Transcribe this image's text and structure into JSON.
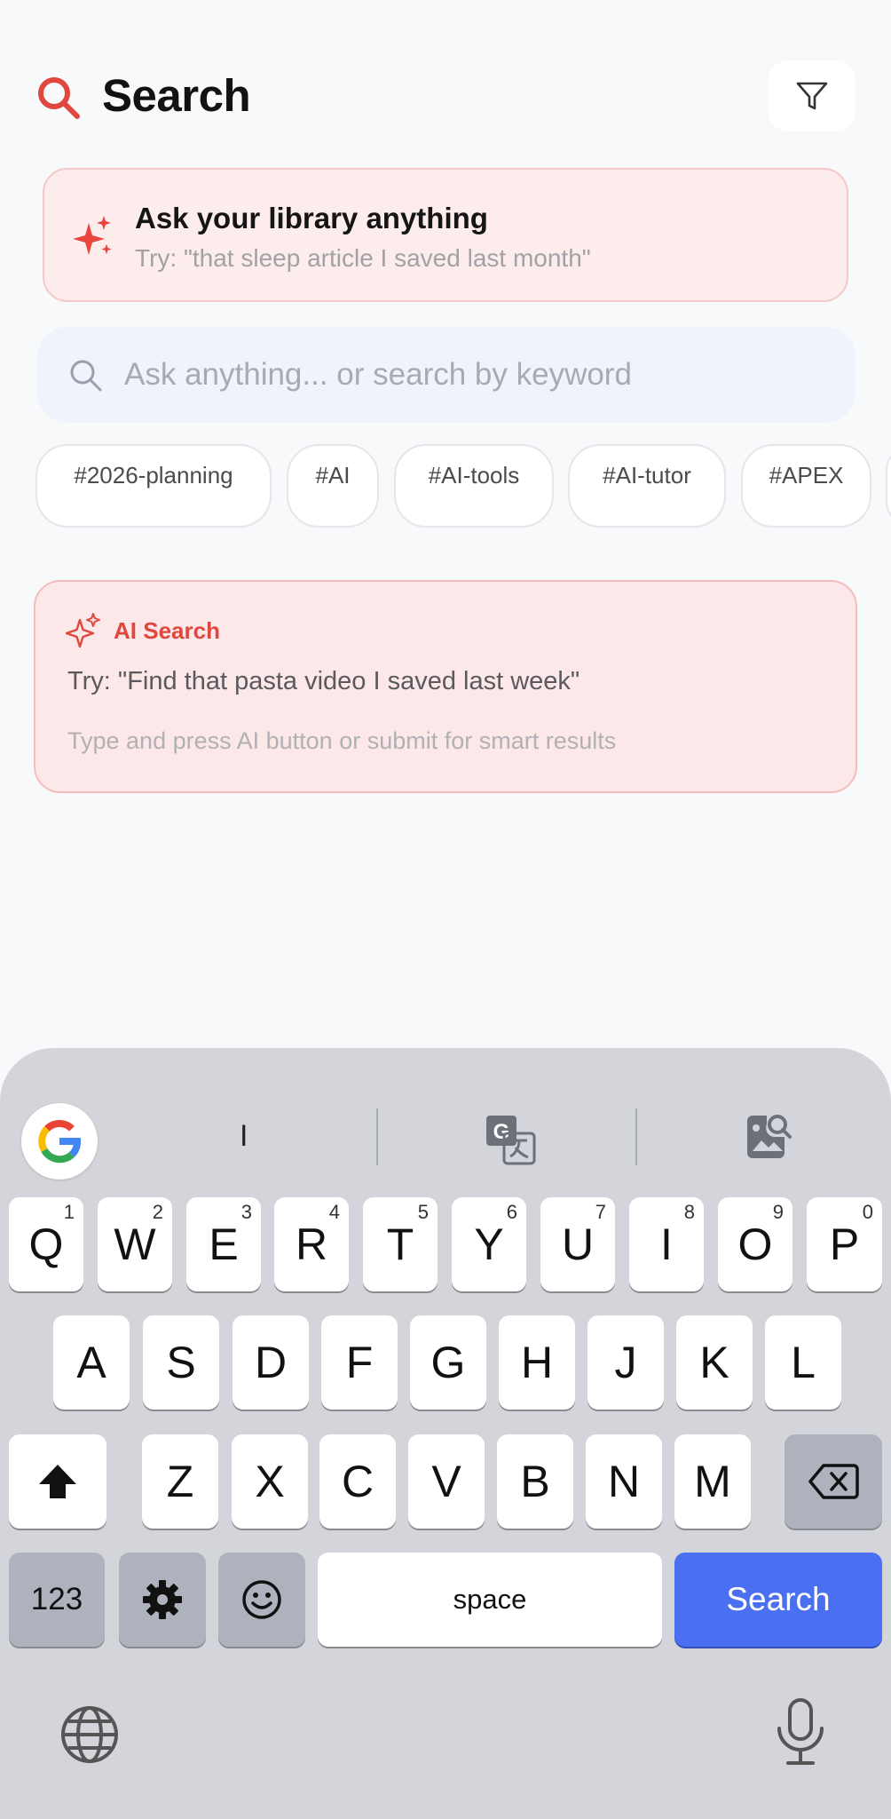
{
  "header": {
    "title": "Search",
    "search_icon": "search-icon",
    "filter_icon": "filter-icon"
  },
  "ask_banner": {
    "title": "Ask your library anything",
    "subtitle": "Try: \"that sleep article I saved last month\"",
    "icon": "sparkle-icon"
  },
  "search": {
    "placeholder": "Ask anything... or search by keyword",
    "value": ""
  },
  "tags": [
    "#2026-planning",
    "#AI",
    "#AI-tools",
    "#AI-tutor",
    "#APEX"
  ],
  "ai_card": {
    "title": "AI Search",
    "example": "Try: \"Find that pasta video I saved last week\"",
    "hint": "Type and press AI button or submit for smart results"
  },
  "keyboard": {
    "suggestion": "I",
    "row1": [
      {
        "label": "Q",
        "hint": "1"
      },
      {
        "label": "W",
        "hint": "2"
      },
      {
        "label": "E",
        "hint": "3"
      },
      {
        "label": "R",
        "hint": "4"
      },
      {
        "label": "T",
        "hint": "5"
      },
      {
        "label": "Y",
        "hint": "6"
      },
      {
        "label": "U",
        "hint": "7"
      },
      {
        "label": "I",
        "hint": "8"
      },
      {
        "label": "O",
        "hint": "9"
      },
      {
        "label": "P",
        "hint": "0"
      }
    ],
    "row2": [
      "A",
      "S",
      "D",
      "F",
      "G",
      "H",
      "J",
      "K",
      "L"
    ],
    "row3": [
      "Z",
      "X",
      "C",
      "V",
      "B",
      "N",
      "M"
    ],
    "numbers_label": "123",
    "space_label": "space",
    "search_label": "Search",
    "accent_color": "#4a6ff0"
  },
  "colors": {
    "brand_red": "#e0473e",
    "banner_bg": "#fcecec",
    "search_bg": "#eff3fb"
  }
}
